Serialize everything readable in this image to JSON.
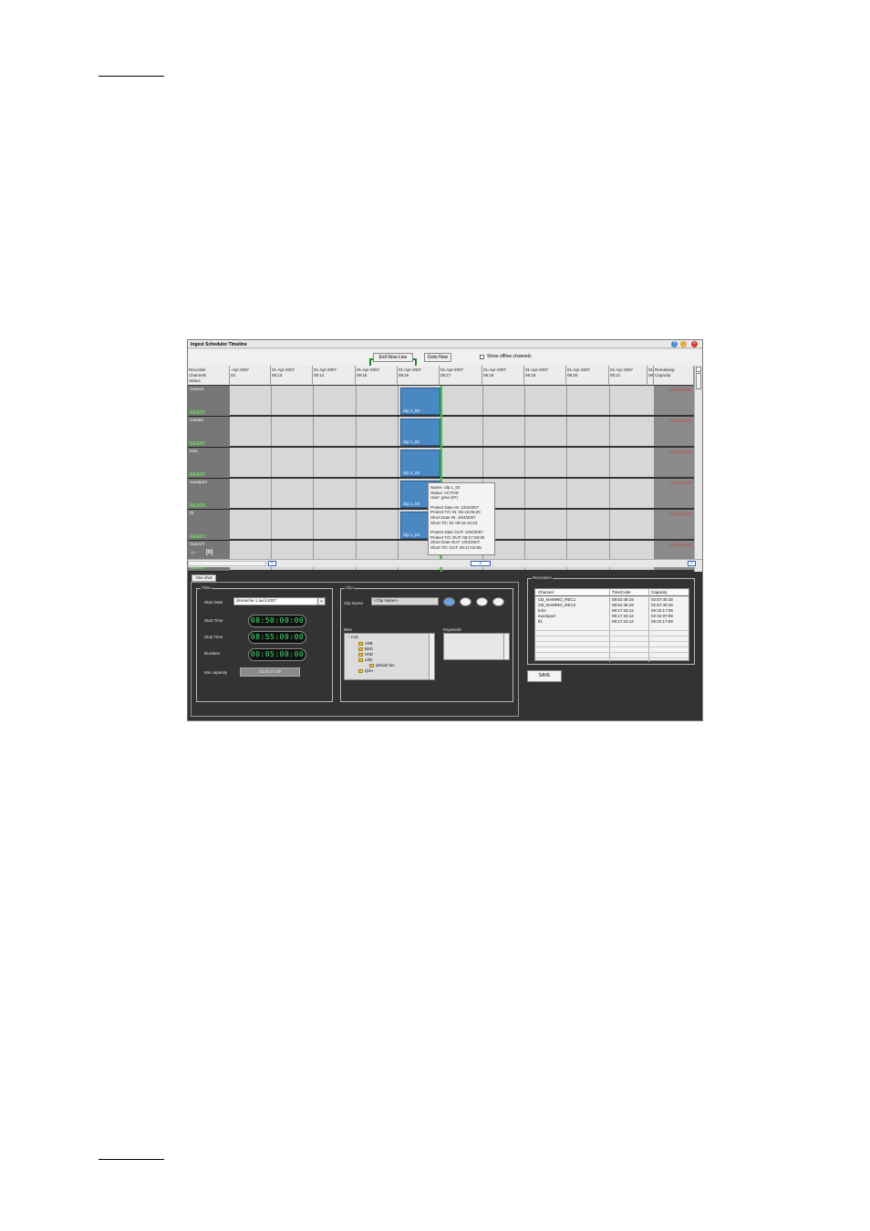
{
  "window": {
    "title": "Ingest Scheduler Timeline",
    "exit_now_line": "Exit Now Line",
    "goto_now": "Goto Now",
    "show_offline": "Show offline channels"
  },
  "timeline": {
    "header_left": [
      "Recorder",
      "Channels",
      "Status"
    ],
    "header_right": [
      "Remaining",
      "Capacity"
    ],
    "columns": [
      {
        "date": "-Apr-2007",
        "time": "02"
      },
      {
        "date": "01-Apr-2007",
        "time": "09:13"
      },
      {
        "date": "01-Apr-2007",
        "time": "09:14"
      },
      {
        "date": "01-Apr-2007",
        "time": "09:15"
      },
      {
        "date": "01-Apr-2007",
        "time": "09:16"
      },
      {
        "date": "01-Apr-2007",
        "time": "09:17"
      },
      {
        "date": "01-Apr-2007",
        "time": "09:18"
      },
      {
        "date": "01-Apr-2007",
        "time": "09:19"
      },
      {
        "date": "01-Apr-2007",
        "time": "09:20"
      },
      {
        "date": "01-Apr-2007",
        "time": "09:21"
      },
      {
        "date": "01",
        "time": "09"
      }
    ],
    "channels": [
      {
        "name": "CamA/I",
        "status": "READY",
        "clip": "clip 1_00",
        "capacity": "00:00:00:00"
      },
      {
        "name": "CamB/I",
        "status": "READY",
        "clip": "clip 1_01",
        "capacity": "00:00:00:00"
      },
      {
        "name": "trois",
        "status": "READY",
        "clip": "clip 1_02",
        "capacity": "00:00:00:00"
      },
      {
        "name": "eurosport",
        "status": "READY",
        "clip": "clip 1_03",
        "capacity": "00:00:00:00"
      },
      {
        "name": "tf1",
        "status": "READY",
        "clip": "clip 1_04",
        "capacity": "00:00:00:00"
      },
      {
        "name": "CamA/T",
        "status": "READY",
        "clip": "",
        "capacity": "00:00:00:00"
      }
    ],
    "row6_counter": "[0]",
    "tooltip": [
      "Name: clip 1_02",
      "Status: ACTIVE",
      "User: gma (97)",
      "",
      "Protect Date IN: 1/04/2007",
      "Protect T/C IN: 09:16:05:20",
      "Short Date IN: 1/04/2007",
      "Short T/C IN: 09:16:10:23",
      "",
      "Protect Date OUT: 1/04/2007",
      "Protect T/C OUT: 09:17:08:05",
      "Short Date OUT: 1/04/2007",
      "Short T/C OUT: 09:17:03:05"
    ]
  },
  "oneshot": {
    "tab": "One shot",
    "time_group": "Time",
    "start_date_label": "Start Date",
    "start_date_value": "dimanche   1     avril      2007",
    "start_time_label": "Start Time",
    "start_time": "08:50:00:00",
    "stop_time_label": "Stop Time",
    "stop_time": "08:55:00:00",
    "duration_label": "Duration",
    "duration": "00:05:00:00",
    "min_capacity_label": "Min capacity",
    "min_capacity": "03:42:07:09"
  },
  "clip": {
    "group": "Clip",
    "clip_name_label": "Clip Name",
    "clip_name_value": "<Clip Name>",
    "bins_label": "Bins",
    "keywords_label": "Keywords",
    "bins": [
      "root",
      "A0B",
      "B0G",
      "H0D",
      "L0D",
      "default bin",
      "Q0A"
    ]
  },
  "recorders": {
    "group": "Recorders",
    "headers": [
      "Channel",
      "TimeCode",
      "Capacity"
    ],
    "rows": [
      [
        "CB_NAMING_REC1",
        "08:52:46:19",
        "02:57:40:18"
      ],
      [
        "CB_NAMING_REC2",
        "08:52:46:19",
        "02:57:40:18"
      ],
      [
        "trois",
        "09:17:33:12",
        "05:22:17:09"
      ],
      [
        "eurosport",
        "09:17:33:12",
        "03:42:07:09"
      ],
      [
        "tf1",
        "09:17:33:12",
        "05:22:17:09"
      ]
    ],
    "save": "SAVE"
  }
}
